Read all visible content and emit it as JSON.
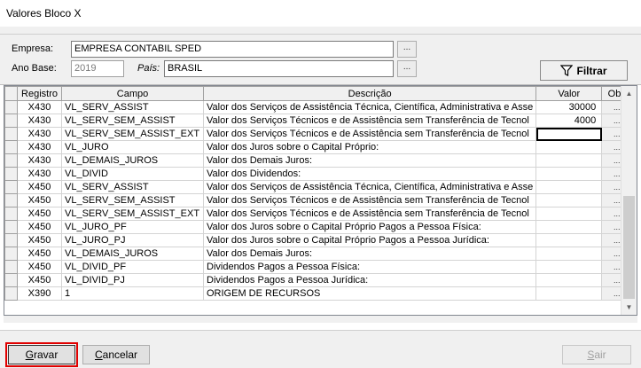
{
  "window": {
    "title": "Valores Bloco X"
  },
  "filters": {
    "empresa_label": "Empresa:",
    "empresa_value": "EMPRESA CONTABIL SPED",
    "ano_label": "Ano Base:",
    "ano_value": "2019",
    "pais_label": "País:",
    "pais_value": "BRASIL",
    "lookup_label": "...",
    "filter_button": "Filtrar"
  },
  "grid": {
    "columns": [
      "Registro",
      "Campo",
      "Descrição",
      "Valor",
      "Obs"
    ],
    "rows": [
      {
        "registro": "X430",
        "campo": "VL_SERV_ASSIST",
        "descricao": "Valor dos Serviços de Assistência Técnica, Científica, Administrativa e Asse",
        "valor": "30000",
        "obs": "..."
      },
      {
        "registro": "X430",
        "campo": "VL_SERV_SEM_ASSIST",
        "descricao": "Valor dos Serviços Técnicos e de Assistência sem Transferência de Tecnol",
        "valor": "4000",
        "obs": "..."
      },
      {
        "registro": "X430",
        "campo": "VL_SERV_SEM_ASSIST_EXT",
        "descricao": "Valor dos Serviços Técnicos e de Assistência sem Transferência de Tecnol",
        "valor": "",
        "obs": "..."
      },
      {
        "registro": "X430",
        "campo": "VL_JURO",
        "descricao": "Valor dos Juros sobre o Capital Próprio:",
        "valor": "",
        "obs": "..."
      },
      {
        "registro": "X430",
        "campo": "VL_DEMAIS_JUROS",
        "descricao": "Valor dos Demais Juros:",
        "valor": "",
        "obs": "..."
      },
      {
        "registro": "X430",
        "campo": "VL_DIVID",
        "descricao": "Valor dos Dividendos:",
        "valor": "",
        "obs": "..."
      },
      {
        "registro": "X450",
        "campo": "VL_SERV_ASSIST",
        "descricao": "Valor dos Serviços de Assistência Técnica, Científica, Administrativa e Asse",
        "valor": "",
        "obs": "..."
      },
      {
        "registro": "X450",
        "campo": "VL_SERV_SEM_ASSIST",
        "descricao": "Valor dos Serviços Técnicos e de Assistência sem Transferência de Tecnol",
        "valor": "",
        "obs": "..."
      },
      {
        "registro": "X450",
        "campo": "VL_SERV_SEM_ASSIST_EXT",
        "descricao": "Valor dos Serviços Técnicos e de Assistência sem Transferência de Tecnol",
        "valor": "",
        "obs": "..."
      },
      {
        "registro": "X450",
        "campo": "VL_JURO_PF",
        "descricao": "Valor dos Juros sobre o Capital Próprio Pagos a Pessoa Física:",
        "valor": "",
        "obs": "..."
      },
      {
        "registro": "X450",
        "campo": "VL_JURO_PJ",
        "descricao": "Valor dos Juros sobre o Capital Próprio Pagos a Pessoa Jurídica:",
        "valor": "",
        "obs": "..."
      },
      {
        "registro": "X450",
        "campo": "VL_DEMAIS_JUROS",
        "descricao": "Valor dos Demais Juros:",
        "valor": "",
        "obs": "..."
      },
      {
        "registro": "X450",
        "campo": "VL_DIVID_PF",
        "descricao": "Dividendos Pagos a Pessoa Física:",
        "valor": "",
        "obs": "..."
      },
      {
        "registro": "X450",
        "campo": "VL_DIVID_PJ",
        "descricao": "Dividendos Pagos a Pessoa Jurídica:",
        "valor": "",
        "obs": "..."
      },
      {
        "registro": "X390",
        "campo": "1",
        "descricao": "ORIGEM DE RECURSOS",
        "valor": "",
        "obs": "..."
      }
    ]
  },
  "footer": {
    "gravar_first": "G",
    "gravar_rest": "ravar",
    "cancelar_first": "C",
    "cancelar_rest": "ancelar",
    "sair_first": "S",
    "sair_rest": "air"
  },
  "colors": {
    "highlight": "#e00000",
    "panel": "#f0f0f0"
  }
}
